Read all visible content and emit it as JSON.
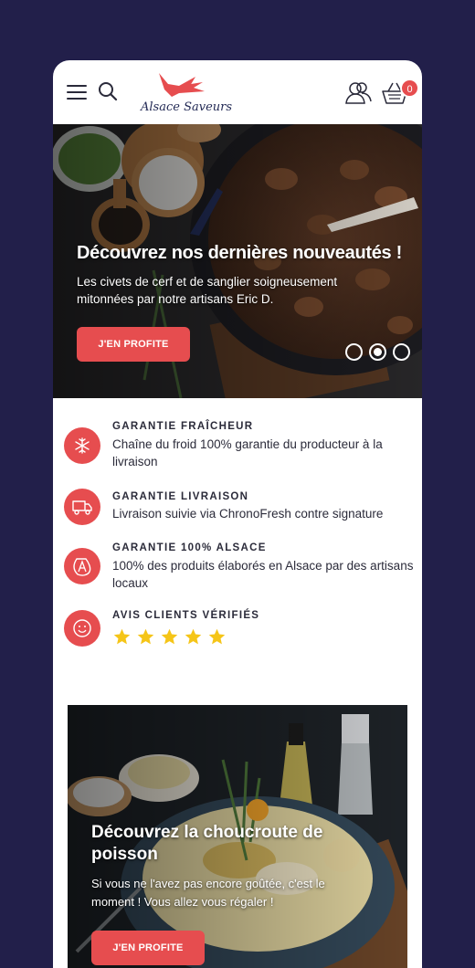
{
  "header": {
    "brand": "Alsace Saveurs",
    "cart_count": "0"
  },
  "hero": {
    "title": "Découvrez nos dernières nouveautés !",
    "subtitle": "Les civets de cerf et de sanglier soigneusement mitonnées par notre artisans Eric D.",
    "cta": "J'EN PROFITE",
    "slide_count": 3,
    "active_slide": 2
  },
  "guarantees": [
    {
      "icon": "snowflake-icon",
      "title": "GARANTIE FRAÎCHEUR",
      "text": "Chaîne du froid 100% garantie du producteur à la livraison"
    },
    {
      "icon": "truck-icon",
      "title": "GARANTIE LIVRAISON",
      "text": "Livraison suivie via ChronoFresh contre signature"
    },
    {
      "icon": "alsace-icon",
      "title": "GARANTIE 100% ALSACE",
      "text": "100% des produits élaborés en Alsace par des artisans locaux"
    },
    {
      "icon": "smiley-icon",
      "title": "AVIS CLIENTS VÉRIFIÉS",
      "rating": 5
    }
  ],
  "promo": {
    "title": "Découvrez la choucroute de poisson",
    "subtitle": "Si vous ne l'avez pas encore goûtée, c'est le moment ! Vous allez vous régaler !",
    "cta": "J'EN PROFITE"
  },
  "colors": {
    "background": "#221f4a",
    "accent": "#e64d4f",
    "star": "#f5c518",
    "brand_text": "#232a55"
  }
}
